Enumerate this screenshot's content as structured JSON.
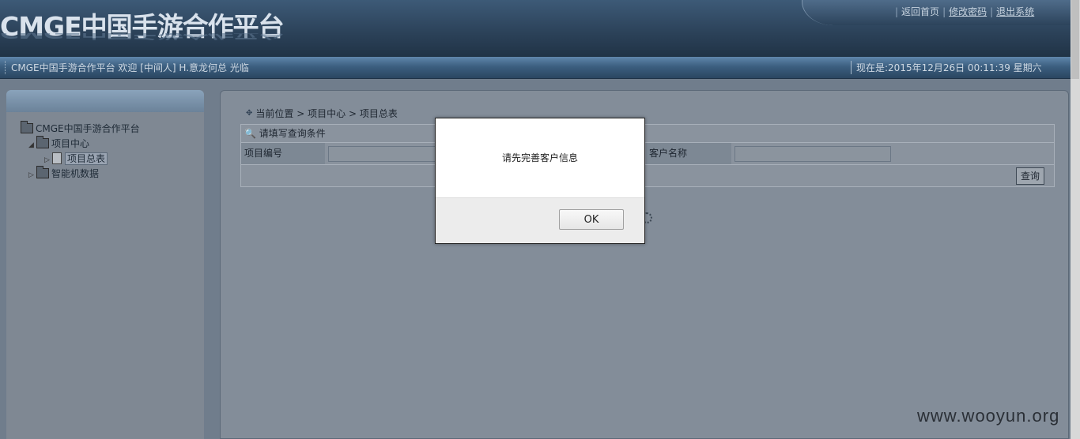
{
  "header": {
    "logo_text": "CMGE中国手游合作平台",
    "links": [
      "返回首页",
      "修改密码",
      "退出系统"
    ]
  },
  "infobar": {
    "welcome": "CMGE中国手游合作平台 欢迎 [中间人] H.意龙何总 光临",
    "clock": "现在是:2015年12月26日 00:11:39 星期六"
  },
  "tree": {
    "root": "CMGE中国手游合作平台",
    "items": [
      {
        "label": "项目中心",
        "expanded": true,
        "children": [
          "项目总表"
        ]
      },
      {
        "label": "智能机数据",
        "expanded": false
      }
    ]
  },
  "breadcrumb": {
    "prefix": "当前位置",
    "items": [
      "项目中心",
      "项目总表"
    ],
    "separator": ">"
  },
  "query": {
    "title": "请填写查询条件",
    "fields": [
      {
        "label": "项目编号",
        "value": ""
      },
      {
        "label": "客户名称",
        "value": ""
      }
    ],
    "button": "查询"
  },
  "dialog": {
    "message": "请先完善客户信息",
    "ok": "OK"
  },
  "watermark": "www.wooyun.org"
}
